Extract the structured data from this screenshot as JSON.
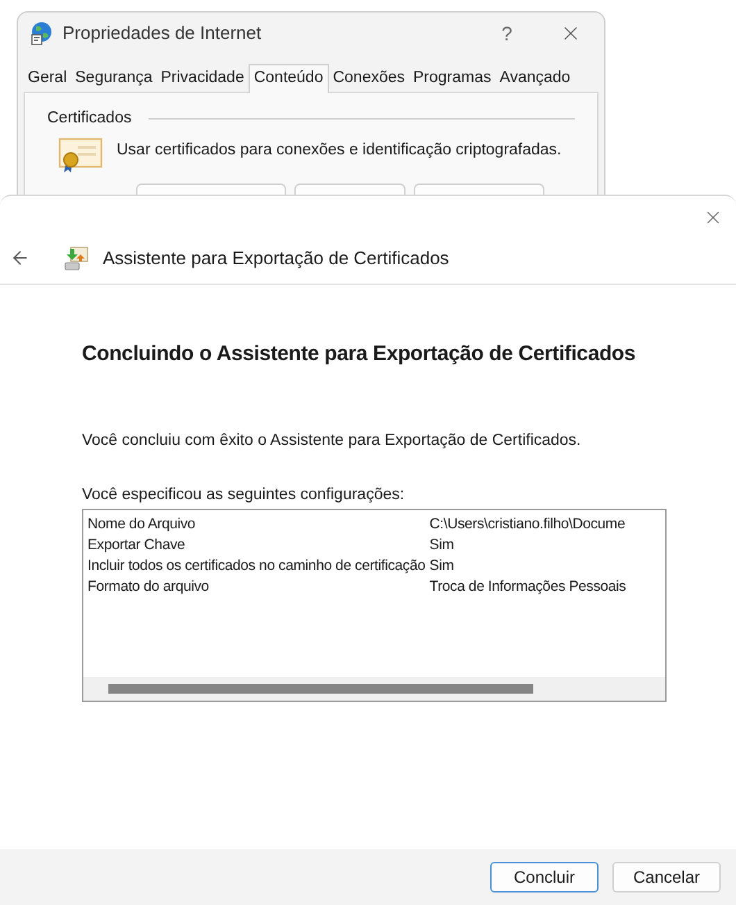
{
  "background_window": {
    "title": "Propriedades de Internet",
    "help": "?",
    "tabs": [
      {
        "label": "Geral",
        "selected": false
      },
      {
        "label": "Segurança",
        "selected": false
      },
      {
        "label": "Privacidade",
        "selected": false
      },
      {
        "label": "Conteúdo",
        "selected": true
      },
      {
        "label": "Conexões",
        "selected": false
      },
      {
        "label": "Programas",
        "selected": false
      },
      {
        "label": "Avançado",
        "selected": false
      }
    ],
    "section": "Certificados",
    "description": "Usar certificados para conexões e identificação criptografadas."
  },
  "wizard": {
    "title": "Assistente para Exportação de Certificados",
    "heading": "Concluindo o Assistente para Exportação de Certificados",
    "message": "Você concluiu com êxito o Assistente para Exportação de Certificados.",
    "list_label": "Você especificou as seguintes configurações:",
    "settings": [
      {
        "name": "Nome do Arquivo",
        "value": "C:\\Users\\cristiano.filho\\Docume"
      },
      {
        "name": "Exportar Chave",
        "value": "Sim"
      },
      {
        "name": "Incluir todos os certificados no caminho de certificação",
        "value": "Sim"
      },
      {
        "name": "Formato do arquivo",
        "value": "Troca de Informações Pessoais"
      }
    ],
    "buttons": [
      {
        "label": "Concluir",
        "default": true
      },
      {
        "label": "Cancelar",
        "default": false
      }
    ]
  }
}
